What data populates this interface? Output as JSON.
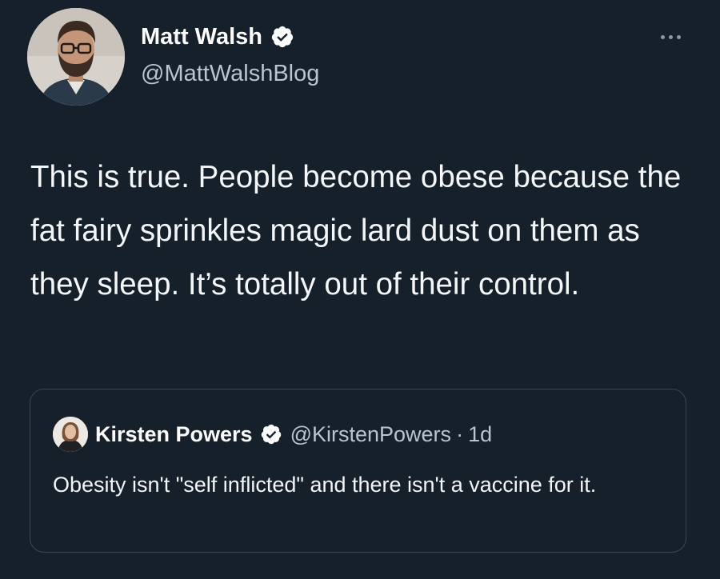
{
  "tweet": {
    "author": {
      "name": "Matt Walsh",
      "handle": "@MattWalshBlog",
      "verified_icon": "verified-badge-icon",
      "avatar_icon": "profile-avatar"
    },
    "more_icon": "more-options-icon",
    "text": "This is true. People become obese because the fat fairy sprinkles magic lard dust on them as they sleep. It’s totally out of their control."
  },
  "quoted_tweet": {
    "author": {
      "name": "Kirsten Powers",
      "handle": "@KirstenPowers",
      "verified_icon": "verified-badge-icon",
      "avatar_icon": "profile-avatar"
    },
    "separator": "·",
    "time": "1d",
    "text": "Obesity isn't \"self inflicted\" and there isn't a vaccine for it."
  },
  "colors": {
    "background": "#15202b",
    "verified": "#ffffff",
    "secondary_text": "#b9c4cf",
    "border": "#3b4650"
  }
}
